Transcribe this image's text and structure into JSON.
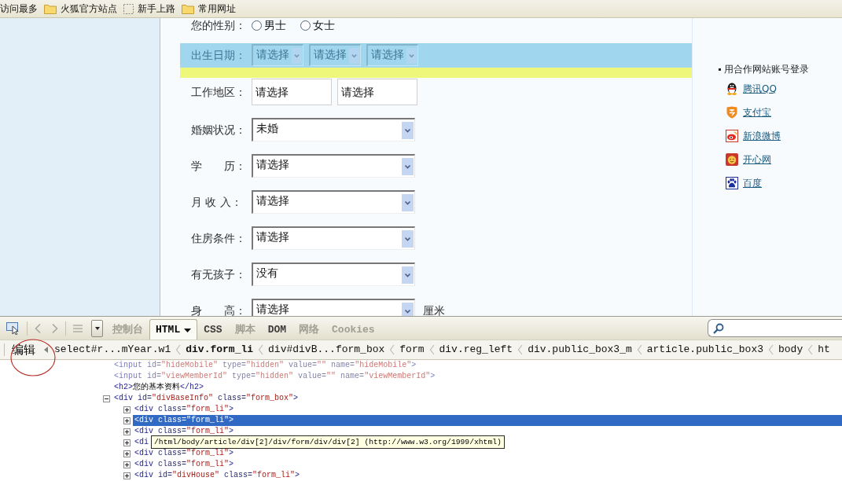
{
  "bookmarks": [
    {
      "label": "访问最多",
      "kind": "plain"
    },
    {
      "label": "火狐官方站点",
      "kind": "folder"
    },
    {
      "label": "新手上路",
      "kind": "dashed"
    },
    {
      "label": "常用网址",
      "kind": "folder"
    }
  ],
  "form": {
    "rows": [
      {
        "label": "您的性别：",
        "highlighted": false,
        "controls": [
          {
            "kind": "radio",
            "label": "男士",
            "selected": false
          },
          {
            "kind": "radio",
            "label": "女士",
            "selected": false
          }
        ]
      },
      {
        "label": "出生日期：",
        "highlighted": true,
        "controls": [
          {
            "kind": "short_select",
            "value": "请选择"
          },
          {
            "kind": "short_select",
            "value": "请选择"
          },
          {
            "kind": "short_select",
            "value": "请选择"
          }
        ]
      },
      {
        "label": "工作地区：",
        "highlighted": false,
        "controls": [
          {
            "kind": "text_box",
            "value": "请选择"
          },
          {
            "kind": "text_box",
            "value": "请选择"
          }
        ]
      },
      {
        "label": "婚姻状况：",
        "highlighted": false,
        "controls": [
          {
            "kind": "select",
            "value": "未婚"
          }
        ]
      },
      {
        "label": "学　　历：",
        "highlighted": false,
        "controls": [
          {
            "kind": "select",
            "value": "请选择"
          }
        ]
      },
      {
        "label": "月 收 入：",
        "highlighted": false,
        "controls": [
          {
            "kind": "select",
            "value": "请选择"
          }
        ]
      },
      {
        "label": "住房条件：",
        "highlighted": false,
        "controls": [
          {
            "kind": "select",
            "value": "请选择"
          }
        ]
      },
      {
        "label": "有无孩子：",
        "highlighted": false,
        "controls": [
          {
            "kind": "select",
            "value": "没有"
          }
        ]
      },
      {
        "label": "身　　高：",
        "highlighted": false,
        "controls": [
          {
            "kind": "select",
            "value": "请选择"
          }
        ],
        "unit": "厘米"
      }
    ]
  },
  "sidebar": {
    "heading": "用合作网站账号登录",
    "links": [
      {
        "label": "腾讯QQ",
        "kind": "penguin"
      },
      {
        "label": "支付宝",
        "kind": "shield"
      },
      {
        "label": "新浪微博",
        "kind": "eye"
      },
      {
        "label": "开心网",
        "kind": "smiley"
      },
      {
        "label": "百度",
        "kind": "paw"
      }
    ]
  },
  "devtools": {
    "tabs": [
      {
        "label": "控制台",
        "selected": false,
        "disabled": true,
        "has_menu": false
      },
      {
        "label": "HTML",
        "selected": true,
        "disabled": false,
        "has_menu": true
      },
      {
        "label": "CSS",
        "selected": false,
        "disabled": false,
        "has_menu": false
      },
      {
        "label": "脚本",
        "selected": false,
        "disabled": true,
        "has_menu": false
      },
      {
        "label": "DOM",
        "selected": false,
        "disabled": false,
        "has_menu": false
      },
      {
        "label": "网络",
        "selected": false,
        "disabled": true,
        "has_menu": false
      },
      {
        "label": "Cookies",
        "selected": false,
        "disabled": true,
        "has_menu": false
      }
    ],
    "edit_button": "编辑",
    "breadcrumbs": [
      {
        "label": "select#r...mYear.w1",
        "selected": false
      },
      {
        "label": "div.form_li",
        "selected": true
      },
      {
        "label": "div#divB...form_box",
        "selected": false
      },
      {
        "label": "form",
        "selected": false
      },
      {
        "label": "div.reg_left",
        "selected": false
      },
      {
        "label": "div.public_box3_m",
        "selected": false
      },
      {
        "label": "article.public_box3",
        "selected": false
      },
      {
        "label": "body",
        "selected": false
      },
      {
        "label": "ht",
        "selected": false
      }
    ],
    "tree": [
      {
        "tokens": [
          {
            "kind": "tag",
            "text": "<input"
          },
          {
            "kind": "attr",
            "text": " id="
          },
          {
            "kind": "value",
            "text": "\"hideMobile\""
          },
          {
            "kind": "attr",
            "text": " type="
          },
          {
            "kind": "value",
            "text": "\"hidden\""
          },
          {
            "kind": "attr",
            "text": " value="
          },
          {
            "kind": "value",
            "text": "\"\""
          },
          {
            "kind": "attr",
            "text": " name="
          },
          {
            "kind": "value",
            "text": "\"hideMobile\""
          },
          {
            "kind": "tag",
            "text": ">"
          }
        ],
        "faded": true,
        "expandable": false,
        "expanded": false,
        "selected": false
      },
      {
        "tokens": [
          {
            "kind": "tag",
            "text": "<input"
          },
          {
            "kind": "attr",
            "text": " id="
          },
          {
            "kind": "value",
            "text": "\"viewMemberId\""
          },
          {
            "kind": "attr",
            "text": " type="
          },
          {
            "kind": "value",
            "text": "\"hidden\""
          },
          {
            "kind": "attr",
            "text": " value="
          },
          {
            "kind": "value",
            "text": "\"\""
          },
          {
            "kind": "attr",
            "text": " name="
          },
          {
            "kind": "value",
            "text": "\"viewMemberId\""
          },
          {
            "kind": "tag",
            "text": ">"
          }
        ],
        "faded": true,
        "expandable": false,
        "expanded": false,
        "selected": false
      },
      {
        "tokens": [
          {
            "kind": "tag",
            "text": "<h2>"
          },
          {
            "kind": "text",
            "text": "您的基本资料"
          },
          {
            "kind": "tag",
            "text": "</h2>"
          }
        ],
        "faded": false,
        "expandable": false,
        "expanded": false,
        "selected": false
      },
      {
        "tokens": [
          {
            "kind": "tag",
            "text": "<div"
          },
          {
            "kind": "attr",
            "text": " id="
          },
          {
            "kind": "value",
            "text": "\"divBaseInfo\""
          },
          {
            "kind": "attr",
            "text": " class="
          },
          {
            "kind": "value",
            "text": "\"form_box\""
          },
          {
            "kind": "tag",
            "text": ">"
          }
        ],
        "faded": false,
        "expandable": true,
        "expanded": true,
        "selected": false,
        "children": [
          {
            "tokens": [
              {
                "kind": "tag",
                "text": "<div"
              },
              {
                "kind": "attr",
                "text": " class="
              },
              {
                "kind": "value",
                "text": "\"form_li\""
              },
              {
                "kind": "tag",
                "text": ">"
              }
            ],
            "faded": false,
            "expandable": true,
            "expanded": false,
            "selected": false
          },
          {
            "tokens": [
              {
                "kind": "tag",
                "text": "<div"
              },
              {
                "kind": "attr",
                "text": " class="
              },
              {
                "kind": "value",
                "text": "\"form_li\""
              },
              {
                "kind": "tag",
                "text": ">"
              }
            ],
            "faded": false,
            "expandable": true,
            "expanded": false,
            "selected": true
          },
          {
            "tokens": [
              {
                "kind": "tag",
                "text": "<div"
              },
              {
                "kind": "attr",
                "text": " class="
              },
              {
                "kind": "value",
                "text": "\"form_li\""
              },
              {
                "kind": "tag",
                "text": ">"
              }
            ],
            "faded": false,
            "expandable": true,
            "expanded": false,
            "selected": false
          },
          {
            "tokens": [
              {
                "kind": "tag",
                "text": "<di"
              }
            ],
            "faded": false,
            "expandable": true,
            "expanded": false,
            "selected": false,
            "tooltip": "/html/body/article/div[2]/div/form/div/div[2] (http://www.w3.org/1999/xhtml)"
          },
          {
            "tokens": [
              {
                "kind": "tag",
                "text": "<div"
              },
              {
                "kind": "attr",
                "text": " class="
              },
              {
                "kind": "value",
                "text": "\"form_li\""
              },
              {
                "kind": "tag",
                "text": ">"
              }
            ],
            "faded": false,
            "expandable": true,
            "expanded": false,
            "selected": false
          },
          {
            "tokens": [
              {
                "kind": "tag",
                "text": "<div"
              },
              {
                "kind": "attr",
                "text": " class="
              },
              {
                "kind": "value",
                "text": "\"form_li\""
              },
              {
                "kind": "tag",
                "text": ">"
              }
            ],
            "faded": false,
            "expandable": true,
            "expanded": false,
            "selected": false
          },
          {
            "tokens": [
              {
                "kind": "tag",
                "text": "<div"
              },
              {
                "kind": "attr",
                "text": " id="
              },
              {
                "kind": "value",
                "text": "\"divHouse\""
              },
              {
                "kind": "attr",
                "text": " class="
              },
              {
                "kind": "value",
                "text": "\"form_li\""
              },
              {
                "kind": "tag",
                "text": ">"
              }
            ],
            "faded": false,
            "expandable": true,
            "expanded": false,
            "selected": false
          }
        ]
      }
    ]
  }
}
